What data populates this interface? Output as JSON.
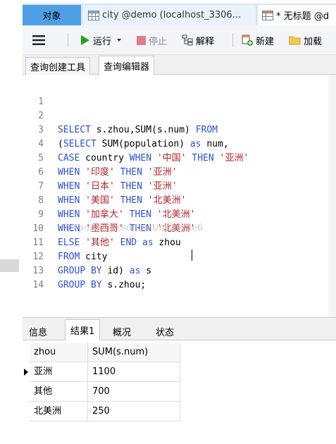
{
  "tabs": [
    {
      "label": "对象"
    },
    {
      "label": "city @demo (localhost_3306..."
    },
    {
      "label": "* 无标题 @d"
    }
  ],
  "toolbar": {
    "run_label": "运行",
    "stop_label": "停止",
    "explain_label": "解释",
    "new_label": "新建",
    "load_label": "加载"
  },
  "subtabs": [
    {
      "label": "查询创建工具"
    },
    {
      "label": "查询编辑器"
    }
  ],
  "editor": {
    "line_numbers": [
      "1",
      "2",
      "3",
      "4",
      "5",
      "6",
      "7",
      "8",
      "9",
      "10",
      "11",
      "12",
      "13",
      "14"
    ],
    "watermark": "http://blog.csdn.net/muriyue6"
  },
  "result_tabs": [
    {
      "label": "信息"
    },
    {
      "label": "结果1"
    },
    {
      "label": "概况"
    },
    {
      "label": "状态"
    }
  ],
  "grid": {
    "columns": [
      "zhou",
      "SUM(s.num)"
    ],
    "rows": [
      [
        "亚洲",
        "1100"
      ],
      [
        "其他",
        "700"
      ],
      [
        "北美洲",
        "250"
      ]
    ]
  },
  "colors": {
    "keyword": "#2e4fd6",
    "string": "#b4232a",
    "active_tab": "#4e9fe4",
    "run_green": "#1aa51a",
    "stop_pink": "#e07b8c"
  }
}
